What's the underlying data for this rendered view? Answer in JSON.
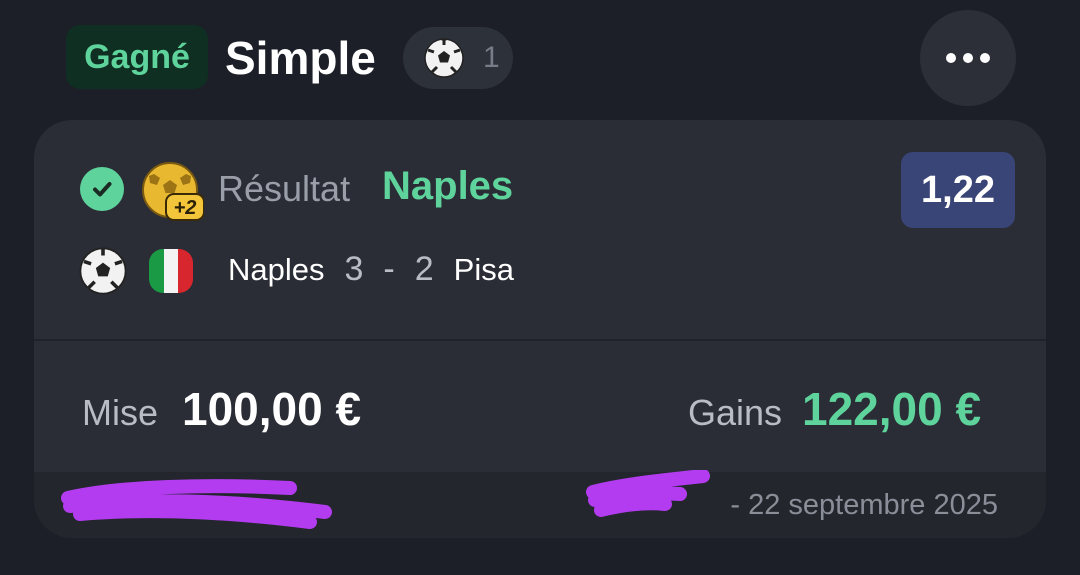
{
  "header": {
    "status_badge": "Gagné",
    "title": "Simple",
    "sport_count": "1",
    "sport_icon": "soccer-ball-icon",
    "menu_icon": "more-options-icon"
  },
  "selection": {
    "status_icon": "check-icon",
    "boost_icon": "boost-plus2-icon",
    "market_label": "Résultat",
    "pick": "Naples",
    "odds": "1,22",
    "sport_icon": "soccer-ball-icon",
    "country_flag": "italy-flag-icon",
    "home_team": "Naples",
    "home_score": "3",
    "separator": "-",
    "away_score": "2",
    "away_team": "Pisa"
  },
  "totals": {
    "stake_label": "Mise",
    "stake_value": "100,00 €",
    "gains_label": "Gains",
    "gains_value": "122,00 €"
  },
  "footer": {
    "reference": "",
    "date_text": "- 22 septembre 2025"
  },
  "colors": {
    "background": "#1c1f27",
    "card": "#2a2d35",
    "accent_green": "#5ed39c",
    "odds_badge": "#3a4577",
    "redaction": "#b43cf0"
  }
}
